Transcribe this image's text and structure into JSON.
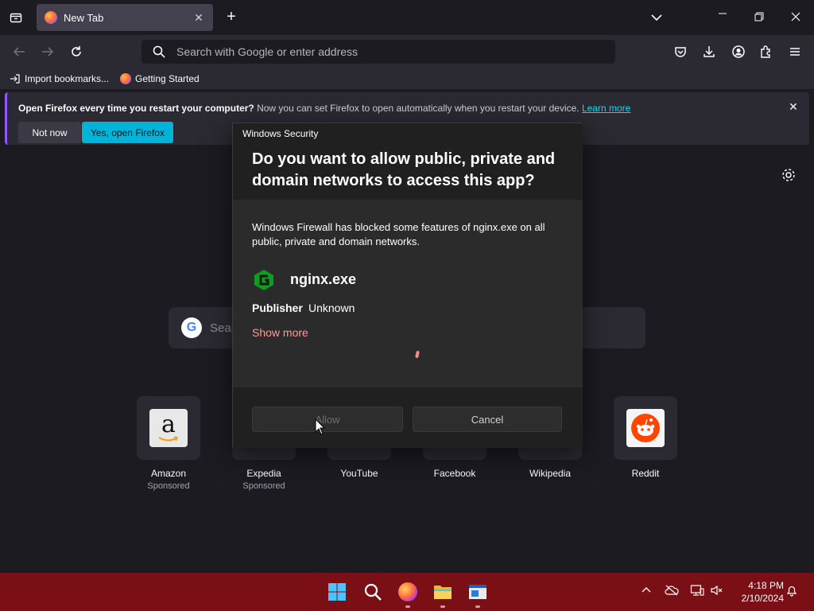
{
  "browser": {
    "tab_title": "New Tab",
    "url_placeholder": "Search with Google or enter address",
    "bookmarks": [
      "Import bookmarks...",
      "Getting Started"
    ]
  },
  "notification": {
    "bold": "Open Firefox every time you restart your computer?",
    "text": " Now you can set Firefox to open automatically when you restart your device. ",
    "link": "Learn more",
    "not_now": "Not now",
    "yes_open": "Yes, open Firefox"
  },
  "newtab": {
    "search_placeholder": "Sear",
    "sites": [
      {
        "label": "Amazon",
        "sponsored": "Sponsored"
      },
      {
        "label": "Expedia",
        "sponsored": "Sponsored"
      },
      {
        "label": "YouTube",
        "sponsored": ""
      },
      {
        "label": "Facebook",
        "sponsored": ""
      },
      {
        "label": "Wikipedia",
        "sponsored": ""
      },
      {
        "label": "Reddit",
        "sponsored": ""
      }
    ]
  },
  "dialog": {
    "app_name": "Windows Security",
    "title": "Do you want to allow public, private and domain networks to access this app?",
    "description": "Windows Firewall has blocked some features of nginx.exe on all public, private and domain networks.",
    "program": "nginx.exe",
    "publisher_label": "Publisher",
    "publisher_value": "Unknown",
    "show_more": "Show more",
    "allow": "Allow",
    "cancel": "Cancel"
  },
  "taskbar": {
    "time": "4:18 PM",
    "date": "2/10/2024"
  },
  "colors": {
    "taskbar": "#7a0f16",
    "accent_button": "#00b3d9",
    "link": "#00ddff",
    "show_more": "#ff9a9a"
  }
}
